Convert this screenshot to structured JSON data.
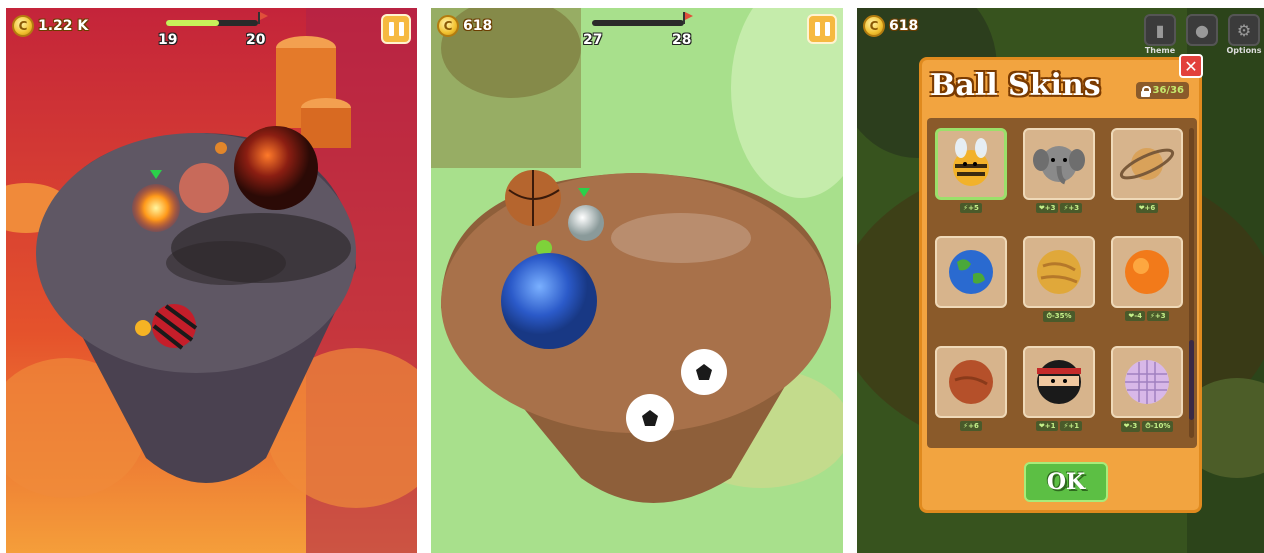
{
  "screens": [
    {
      "coins": "1.22 K",
      "level_current": "19",
      "level_next": "20",
      "progress": 0.58
    },
    {
      "coins": "618",
      "level_current": "27",
      "level_next": "28",
      "progress": 0.0
    },
    {
      "coins": "618",
      "top_menu": [
        {
          "label": "Theme",
          "icon": "theme-icon"
        },
        {
          "label": "",
          "icon": "ball-icon"
        },
        {
          "label": "Options",
          "icon": "gear-icon"
        }
      ],
      "dialog": {
        "title": "Ball Skins",
        "unlocked_count": "36/36",
        "close_label": "✕",
        "ok_label": "OK",
        "skins": [
          {
            "name": "bee",
            "bonuses": [
              "⚡+5"
            ]
          },
          {
            "name": "elephant",
            "bonuses": [
              "❤+3",
              "⚡+3"
            ]
          },
          {
            "name": "saturn",
            "bonuses": [
              "❤+6"
            ]
          },
          {
            "name": "earth",
            "bonuses": []
          },
          {
            "name": "venus",
            "bonuses": [
              "⏱-35%"
            ]
          },
          {
            "name": "sun",
            "bonuses": [
              "❤-4",
              "⚡+3"
            ]
          },
          {
            "name": "mars",
            "bonuses": [
              "⚡+6"
            ]
          },
          {
            "name": "ninja",
            "bonuses": [
              "❤+1",
              "⚡+1"
            ]
          },
          {
            "name": "disco",
            "bonuses": [
              "❤-3",
              "⏱-10%"
            ]
          }
        ]
      }
    }
  ],
  "colors": {
    "accent_orange": "#f2a440",
    "ok_green": "#5cbf44",
    "close_red": "#e2413c",
    "progress_fill": "#c8f05a"
  }
}
